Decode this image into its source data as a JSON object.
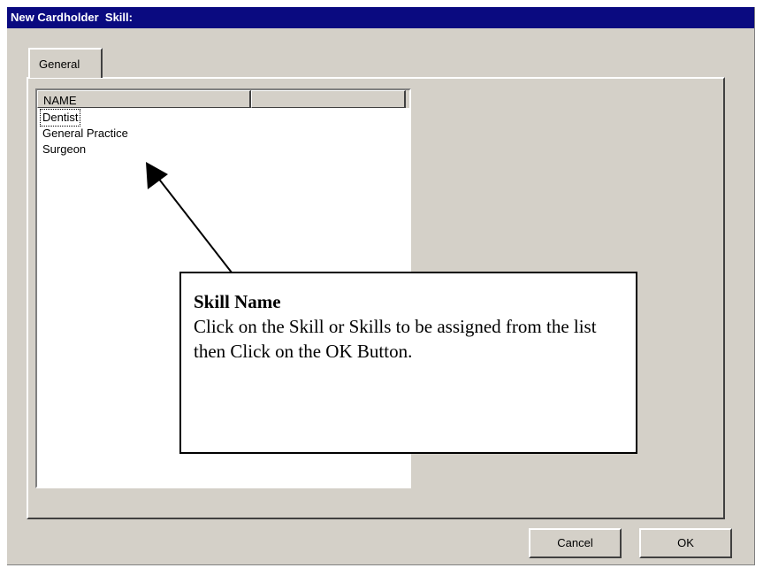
{
  "window": {
    "title": "New Cardholder  Skill:"
  },
  "tabs": [
    {
      "label": "General"
    }
  ],
  "list": {
    "columns": [
      "NAME",
      ""
    ],
    "rows": [
      "Dentist",
      "General Practice",
      "Surgeon"
    ]
  },
  "callout": {
    "title": "Skill Name",
    "body": "Click on the Skill or Skills to be assigned from the list then Click on the OK Button."
  },
  "buttons": {
    "cancel": "Cancel",
    "ok": "OK"
  },
  "colors": {
    "titlebar": "#0a0a80",
    "face": "#d4d0c8"
  }
}
